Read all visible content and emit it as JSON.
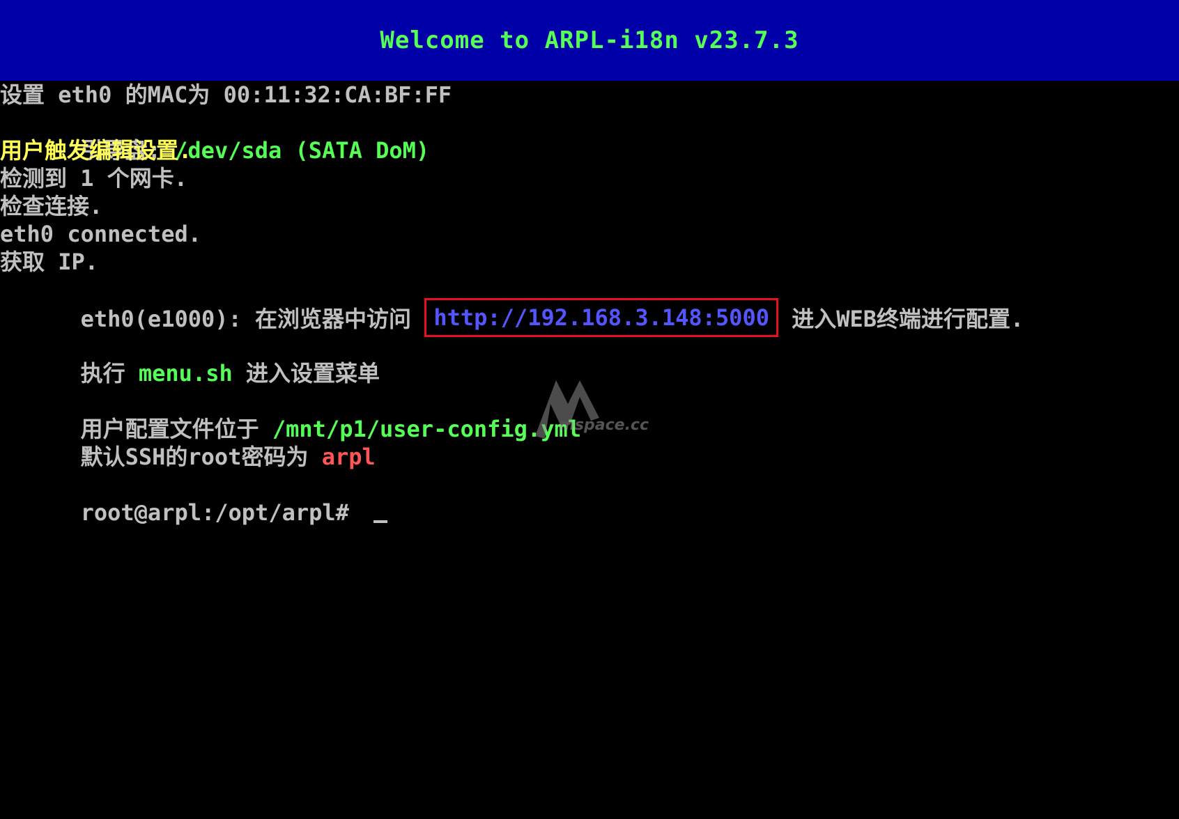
{
  "banner": {
    "title": "Welcome to ARPL-i18n v23.7.3"
  },
  "terminal": {
    "line1": "设置 eth0 的MAC为 00:11:32:CA:BF:FF",
    "line2_label": "引导盘: ",
    "line2_path": "/dev/sda",
    "line2_rest": " (SATA DoM)",
    "line3": "用户触发编辑设置.",
    "line4": "检测到 1 个网卡.",
    "line5": "检查连接.",
    "line6": "eth0 connected.",
    "line7": "获取 IP.",
    "line8_prefix": "eth0(e1000): 在浏览器中访问 ",
    "line8_url": "http://192.168.3.148:5000",
    "line8_suffix": " 进入WEB终端进行配置.",
    "line9_prefix": "执行 ",
    "line9_cmd": "menu.sh",
    "line9_suffix": " 进入设置菜单",
    "line10_prefix": "用户配置文件位于 ",
    "line10_path": "/mnt/p1/user-config.yml",
    "line11_prefix": "默认SSH的root密码为 ",
    "line11_password": "arpl",
    "prompt": "root@arpl:/opt/arpl# "
  },
  "watermark": {
    "text": "mspace.cc",
    "icon": "m-logo-icon"
  },
  "colors": {
    "background": "#000000",
    "banner": "#0000a8",
    "text": "#c0c0c0",
    "green": "#55ff55",
    "yellow": "#ffff55",
    "blue": "#5555ff",
    "red": "#ff5555",
    "highlight_box": "#e8111b"
  }
}
